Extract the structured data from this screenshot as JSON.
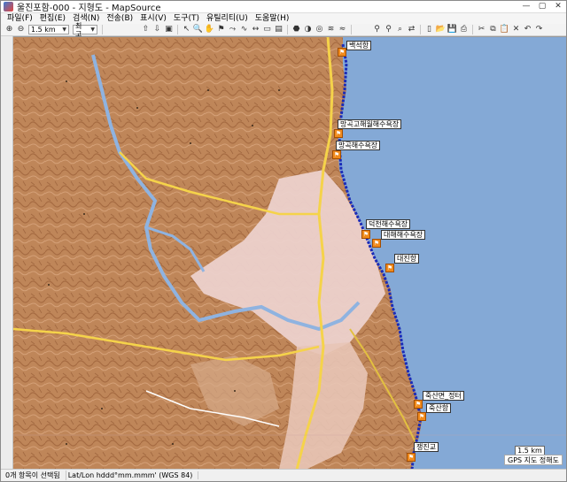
{
  "window": {
    "title": "울진포함-000 - 지형도 - MapSource"
  },
  "titlebar_controls": [
    "—",
    "▢",
    "✕"
  ],
  "menu": [
    "파일(F)",
    "편집(E)",
    "검색(N)",
    "전송(B)",
    "표시(V)",
    "도구(T)",
    "유틸리티(U)",
    "도움말(H)"
  ],
  "toolbar": {
    "zoom_value": "1.5 km",
    "detail_value": "최고"
  },
  "map": {
    "poi_labels": [
      {
        "key": "p1",
        "text": "백석항"
      },
      {
        "key": "p2",
        "text": "망곡고해월해수욕장"
      },
      {
        "key": "p3",
        "text": "망곡해수욕장"
      },
      {
        "key": "p4",
        "text": "덕천해수욕장"
      },
      {
        "key": "p5",
        "text": "대해해수욕장"
      },
      {
        "key": "p6",
        "text": "대진항"
      },
      {
        "key": "p7",
        "text": "죽산면_정터"
      },
      {
        "key": "p8",
        "text": "죽산항"
      },
      {
        "key": "p9",
        "text": "쟁진교"
      }
    ],
    "scale_text": "1.5 km",
    "gps_note": "GPS 지도 정해도",
    "colors": {
      "sea": "#84a9d6",
      "terrain": "#b97f55",
      "route": "#1a2bb8",
      "poi": "#f08a1c"
    }
  },
  "status": {
    "selection": "0개 항목이 선택됨",
    "coord_format": "Lat/Lon hddd°mm.mmm' (WGS 84)"
  }
}
